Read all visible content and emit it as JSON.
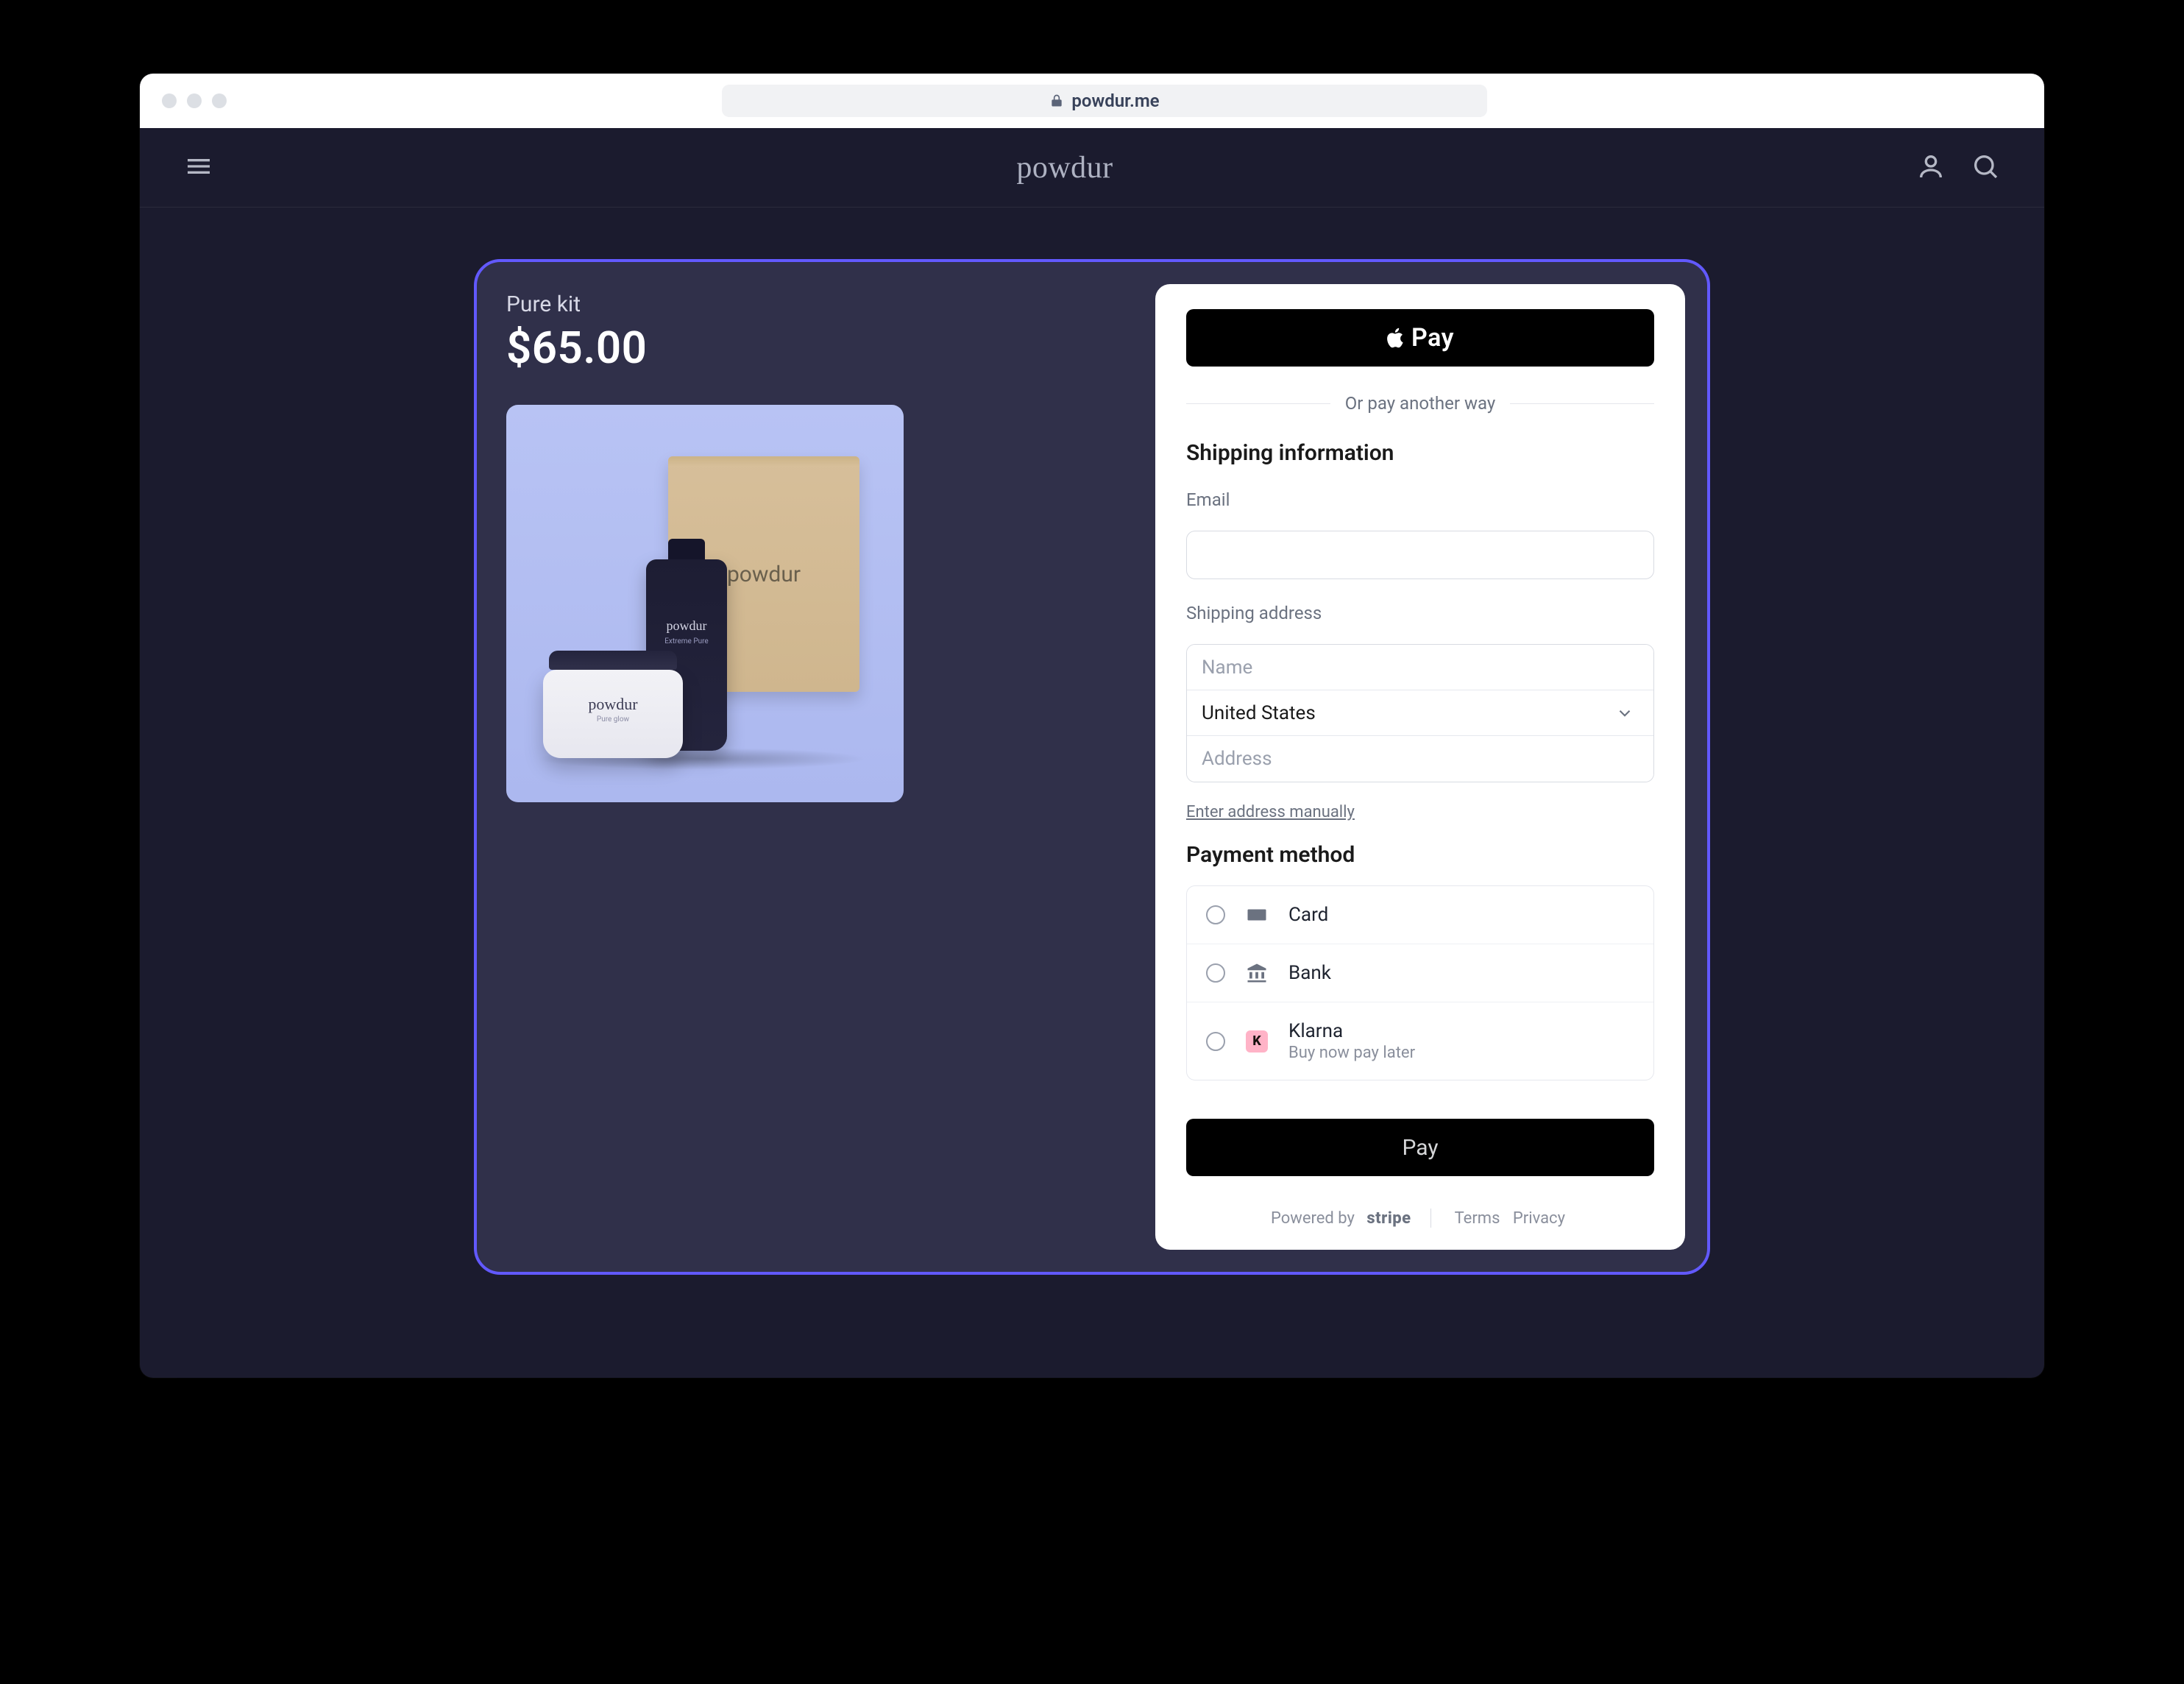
{
  "browser": {
    "url": "powdur.me"
  },
  "site": {
    "brand": "powdur"
  },
  "product": {
    "name": "Pure kit",
    "price": "$65.00",
    "box_label": "powdur",
    "tube_label": "powdur",
    "tube_sub": "Extreme Pure",
    "jar_label": "powdur",
    "jar_sub": "Pure glow"
  },
  "checkout": {
    "apple_pay": "Pay",
    "or_pay": "Or pay another way",
    "shipping_title": "Shipping information",
    "email_label": "Email",
    "shipping_addr_label": "Shipping address",
    "name_placeholder": "Name",
    "country": "United States",
    "address_placeholder": "Address",
    "manual_link": "Enter address manually",
    "pm_title": "Payment method",
    "pm": {
      "card": "Card",
      "bank": "Bank",
      "klarna": "Klarna",
      "klarna_sub": "Buy now pay later"
    },
    "pay_button": "Pay",
    "powered_by": "Powered by",
    "stripe": "stripe",
    "terms": "Terms",
    "privacy": "Privacy"
  }
}
